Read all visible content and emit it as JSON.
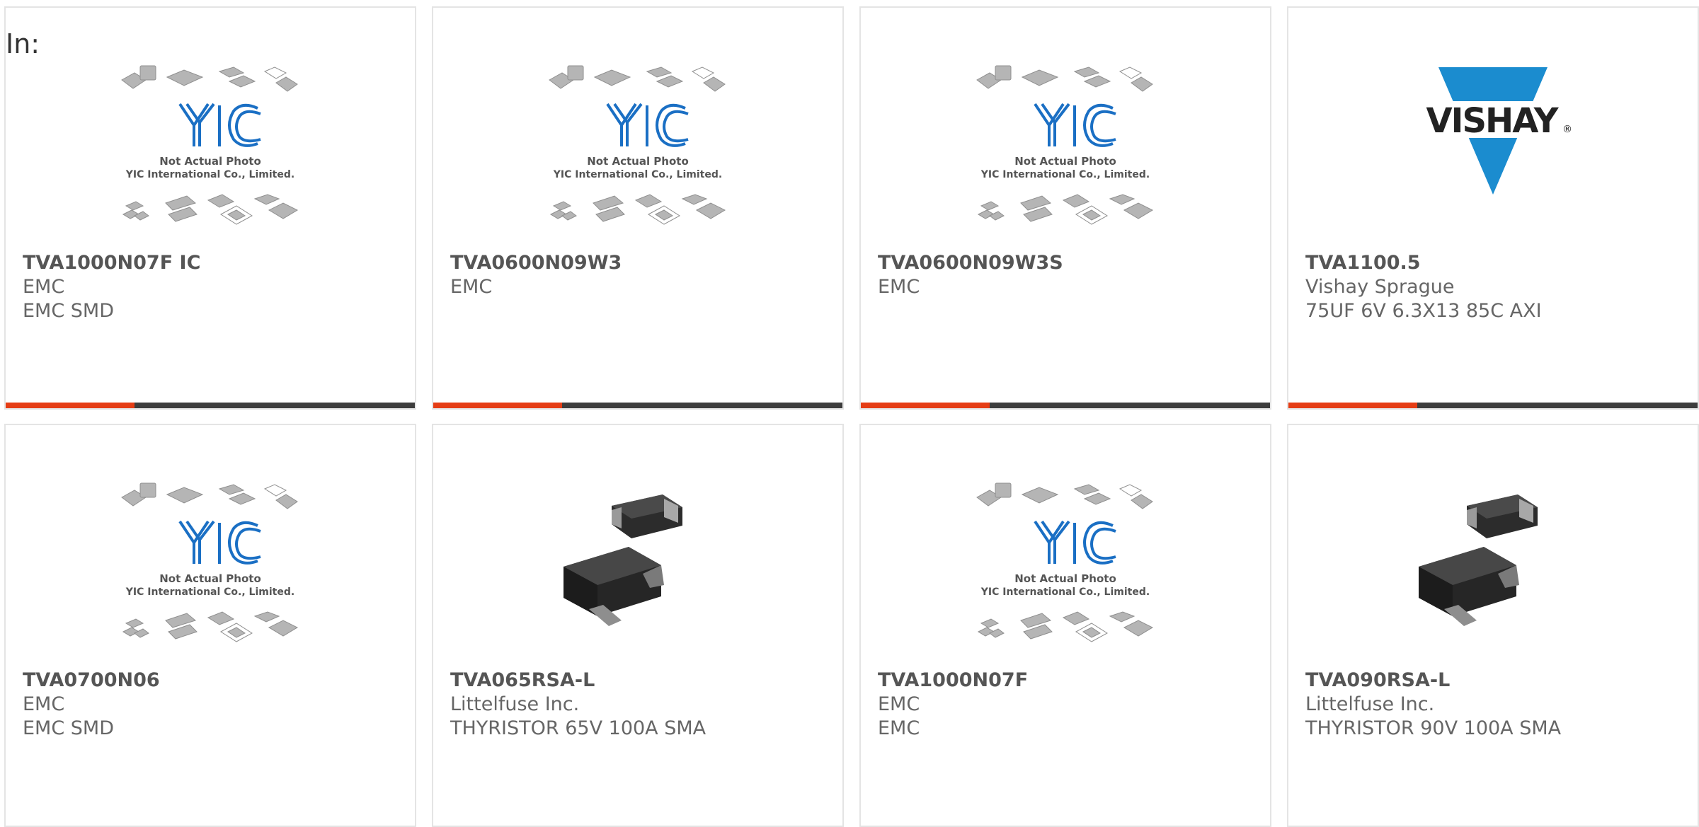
{
  "header": {
    "in_label": "In:"
  },
  "placeholder_image": {
    "line1": "Not Actual Photo",
    "line2": "YIC International Co., Limited.",
    "logo": "YIC"
  },
  "vishay_logo": {
    "text": "VISHAY",
    "mark": "®"
  },
  "colors": {
    "accent": "#e53d15",
    "bar": "#3d3d3d",
    "yic_blue": "#1a6fc4",
    "vishay_blue": "#1b8ccf"
  },
  "cards": [
    {
      "title": "TVA1000N07F IC",
      "maker": "EMC",
      "desc": "EMC SMD",
      "image": "yic-placeholder"
    },
    {
      "title": "TVA0600N09W3",
      "maker": "EMC",
      "desc": "",
      "image": "yic-placeholder"
    },
    {
      "title": "TVA0600N09W3S",
      "maker": "EMC",
      "desc": "",
      "image": "yic-placeholder"
    },
    {
      "title": "TVA1100.5",
      "maker": "Vishay Sprague",
      "desc": "75UF 6V 6.3X13 85C AXI",
      "image": "vishay-logo"
    },
    {
      "title": "TVA0700N06",
      "maker": "EMC",
      "desc": "EMC SMD",
      "image": "yic-placeholder"
    },
    {
      "title": "TVA065RSA-L",
      "maker": "Littelfuse Inc.",
      "desc": "THYRISTOR 65V 100A SMA",
      "image": "sma-package"
    },
    {
      "title": "TVA1000N07F",
      "maker": "EMC",
      "desc": "EMC",
      "image": "yic-placeholder"
    },
    {
      "title": "TVA090RSA-L",
      "maker": "Littelfuse Inc.",
      "desc": "THYRISTOR 90V 100A SMA",
      "image": "sma-package"
    }
  ]
}
